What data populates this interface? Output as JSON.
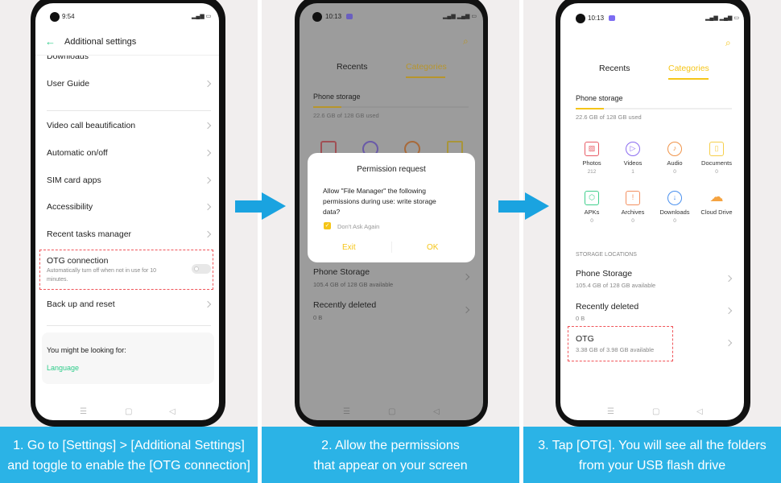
{
  "steps": [
    {
      "caption_line1": "1. Go to [Settings] > [Additional Settings]",
      "caption_line2": "and toggle to enable the [OTG connection]"
    },
    {
      "caption_line1": "2. Allow the permissions",
      "caption_line2": "that appear on your screen"
    },
    {
      "caption_line1": "3. Tap [OTG]. You will see all the folders",
      "caption_line2": "from your USB flash drive"
    }
  ],
  "phone1": {
    "time": "9:54",
    "title": "Additional settings",
    "items": [
      "Downloads",
      "User Guide",
      "Video call beautification",
      "Automatic on/off",
      "SIM card apps",
      "Accessibility",
      "Recent tasks manager"
    ],
    "otg": {
      "title": "OTG connection",
      "desc_line1": "Automatically turn off when not in use for 10",
      "desc_line2": "minutes.",
      "enabled": false
    },
    "backup": "Back up and reset",
    "suggest_title": "You might be looking for:",
    "suggest_link": "Language"
  },
  "phone2": {
    "time": "10:13",
    "tabs": [
      "Recents",
      "Categories"
    ],
    "storage_title": "Phone storage",
    "storage_used": "22.6 GB of 128 GB used",
    "storage_fraction": 0.18,
    "dialog": {
      "title": "Permission request",
      "body_line1": "Allow \"File Manager\" the following",
      "body_line2": "permissions during use: write storage",
      "body_line3": "data?",
      "checkbox": "Don't Ask Again",
      "checked": true,
      "exit": "Exit",
      "ok": "OK"
    },
    "locations": [
      {
        "name": "Phone Storage",
        "detail": "105.4 GB of 128 GB available"
      },
      {
        "name": "Recently deleted",
        "detail": "0 B"
      }
    ]
  },
  "phone3": {
    "time": "10:13",
    "tabs": [
      "Recents",
      "Categories"
    ],
    "storage_title": "Phone storage",
    "storage_used": "22.6 GB of 128 GB used",
    "storage_fraction": 0.18,
    "categories": [
      {
        "name": "Photos",
        "count": "212",
        "icon": "photo-icon",
        "color": "#e85c66"
      },
      {
        "name": "Videos",
        "count": "1",
        "icon": "video-play-icon",
        "color": "#8b6cf0"
      },
      {
        "name": "Audio",
        "count": "0",
        "icon": "music-note-icon",
        "color": "#f0944a"
      },
      {
        "name": "Documents",
        "count": "0",
        "icon": "document-icon",
        "color": "#f6cf4a"
      },
      {
        "name": "APKs",
        "count": "0",
        "icon": "cube-icon",
        "color": "#3fcf8c"
      },
      {
        "name": "Archives",
        "count": "0",
        "icon": "archive-icon",
        "color": "#f39060"
      },
      {
        "name": "Downloads",
        "count": "0",
        "icon": "download-icon",
        "color": "#4a90ee"
      },
      {
        "name": "Cloud Drive",
        "count": "",
        "icon": "cloud-icon",
        "color": "#f5a340"
      }
    ],
    "locations_header": "STORAGE LOCATIONS",
    "locations": [
      {
        "name": "Phone Storage",
        "detail": "105.4 GB of 128 GB available"
      },
      {
        "name": "Recently deleted",
        "detail": "0 B"
      },
      {
        "name": "OTG",
        "detail": "3.38 GB of 3.98 GB available"
      }
    ]
  },
  "colors": {
    "accent_yellow": "#f5c518",
    "accent_green": "#2ecc8a",
    "caption_blue": "#2bb3e6",
    "highlight_red": "#f0555a"
  }
}
